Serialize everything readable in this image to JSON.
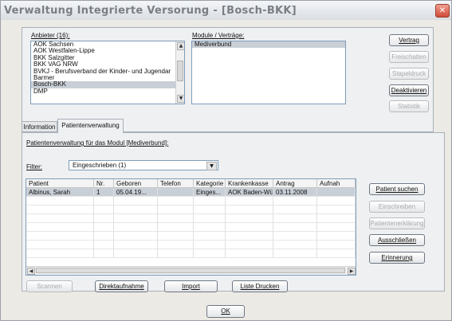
{
  "window": {
    "title": "Verwaltung Integrierte Versorung - [Bosch-BKK]",
    "close_glyph": "✕"
  },
  "providers": {
    "label": "Anbieter (16):",
    "items": [
      {
        "label": "AOK Sachsen",
        "selected": false
      },
      {
        "label": "AOK Westfalen-Lippe",
        "selected": false
      },
      {
        "label": "BKK Salzgitter",
        "selected": false
      },
      {
        "label": "BKK VAG NRW",
        "selected": false
      },
      {
        "label": "BVKJ - Berufsverband der Kinder- und Jugendar",
        "selected": false
      },
      {
        "label": "Barmer",
        "selected": false
      },
      {
        "label": "Bosch-BKK",
        "selected": true
      },
      {
        "label": "DMP",
        "selected": false
      }
    ]
  },
  "modules": {
    "label": "Module / Verträge:",
    "items": [
      {
        "label": "Mediverbund",
        "selected": true
      }
    ]
  },
  "right_buttons": {
    "vertrag": "Vertrag",
    "freischalten": "Freischalten",
    "stapeldruck": "Stapeldruck",
    "deaktivieren": "Deaktivieren",
    "statistik": "Statistik"
  },
  "tabs": [
    {
      "label": "Information",
      "active": false
    },
    {
      "label": "Patientenverwaltung",
      "active": true
    }
  ],
  "patient_section": {
    "caption": "Patientenverwaltung für das Modul [Mediverbund]:",
    "filter_label": "Filter:",
    "filter_value": "Eingeschrieben (1)"
  },
  "table": {
    "columns": [
      "Patient",
      "Nr.",
      "Geboren",
      "Telefon",
      "Kategorie",
      "Krankenkasse",
      "Antrag",
      "Aufnah"
    ],
    "rows": [
      [
        "Albinus, Sarah",
        "1",
        "05.04.19...",
        "",
        "Einges...",
        "AOK Baden-Wü...",
        "03.11.2008",
        ""
      ]
    ]
  },
  "side_buttons": {
    "patient_suchen": "Patient suchen",
    "einschreiben": "Einschreiben",
    "patientenerklaerung": "Patientenerklärung",
    "ausschliessen": "Ausschließen",
    "erinnerung": "Erinnerung"
  },
  "bottom_buttons": {
    "scannen": "Scannen",
    "direktaufnahme": "Direktaufnahme",
    "import": "Import",
    "liste_drucken": "Liste Drucken"
  },
  "ok_button": "OK",
  "scroll_glyphs": {
    "up": "▲",
    "down": "▼",
    "left": "◀",
    "right": "▶",
    "dropdown": "▼"
  }
}
